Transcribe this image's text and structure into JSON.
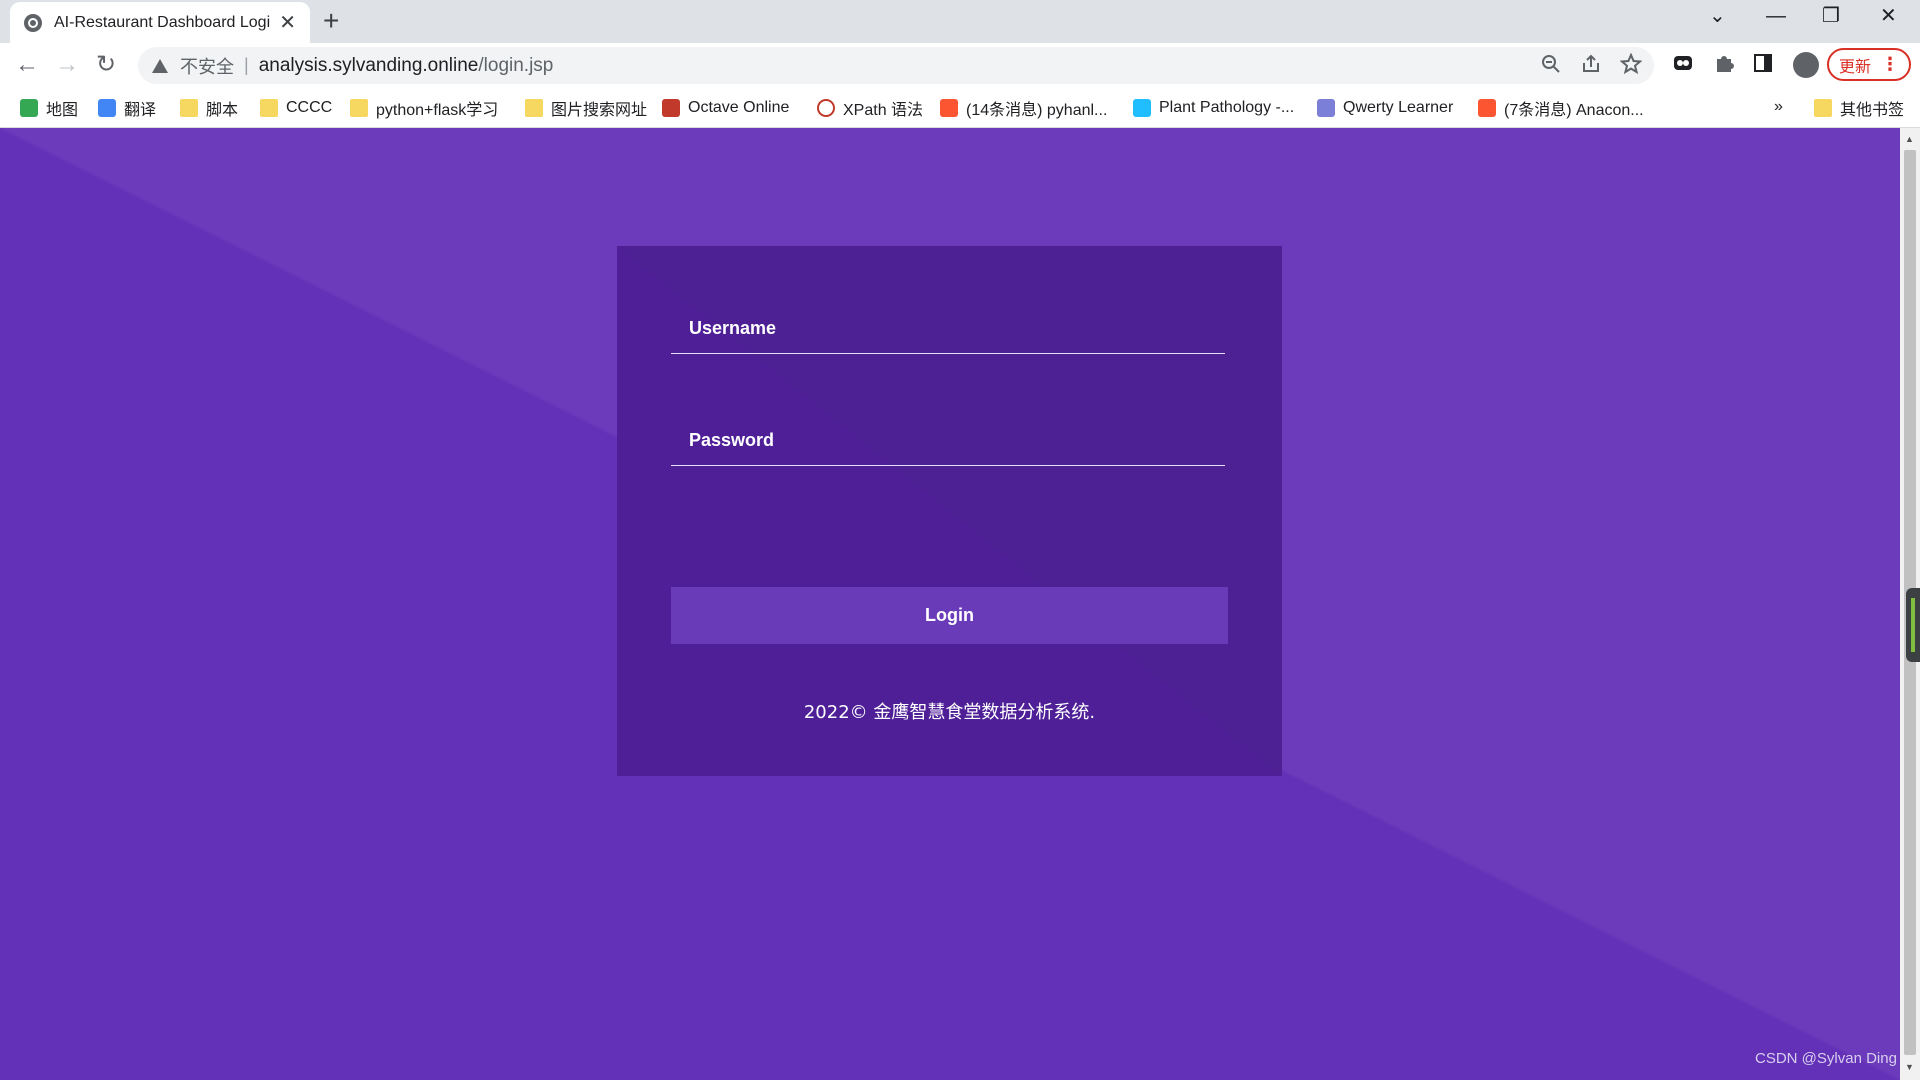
{
  "tab": {
    "title": "AI-Restaurant Dashboard Login",
    "close": "✕",
    "new_tab": "+"
  },
  "window_controls": {
    "tab_search": "⌄",
    "minimize": "—",
    "restore": "❐",
    "close": "✕"
  },
  "toolbar": {
    "back": "←",
    "forward": "→",
    "reload": "↻",
    "security_label": "不安全",
    "separator": "|",
    "url_host": "analysis.sylvanding.online",
    "url_path": "/login.jsp",
    "update_label": "更新",
    "update_menu": "⋮",
    "icons": [
      "zoom-icon",
      "share-icon",
      "star-icon",
      "extension-icon",
      "puzzle-icon",
      "side-panel-icon",
      "avatar-icon"
    ]
  },
  "bookmarks": [
    {
      "label": "地图",
      "icon": "maps-icon",
      "color": "#34a853"
    },
    {
      "label": "翻译",
      "icon": "translate-icon",
      "color": "#4285f4"
    },
    {
      "label": "脚本",
      "icon": "folder-icon",
      "color": "#f6d860"
    },
    {
      "label": "CCCC",
      "icon": "folder-icon",
      "color": "#f6d860"
    },
    {
      "label": "python+flask学习",
      "icon": "folder-icon",
      "color": "#f6d860"
    },
    {
      "label": "图片搜索网址",
      "icon": "folder-icon",
      "color": "#f6d860"
    },
    {
      "label": "Octave Online",
      "icon": "octave-icon",
      "color": "#c0392b"
    },
    {
      "label": "XPath 语法",
      "icon": "xpath-icon",
      "color": "#c0392b"
    },
    {
      "label": "(14条消息) pyhanl...",
      "icon": "csdn-icon",
      "color": "#fc5531"
    },
    {
      "label": "Plant Pathology -...",
      "icon": "kaggle-icon",
      "color": "#20beff"
    },
    {
      "label": "Qwerty Learner",
      "icon": "qwerty-icon",
      "color": "#7b7fd8"
    },
    {
      "label": "(7条消息) Anacon...",
      "icon": "csdn-icon",
      "color": "#fc5531"
    }
  ],
  "bookmarks_more": "»",
  "bookmarks_other": "其他书签",
  "login": {
    "username_placeholder": "Username",
    "password_placeholder": "Password",
    "button_label": "Login",
    "footer": "2022© 金鹰智慧食堂数据分析系统."
  },
  "watermark": "CSDN @Sylvan Ding",
  "colors": {
    "page_bg": "#6330b8",
    "card_bg": "#4e1f97",
    "button_bg": "#6a3bb8",
    "update_red": "#d93025"
  }
}
